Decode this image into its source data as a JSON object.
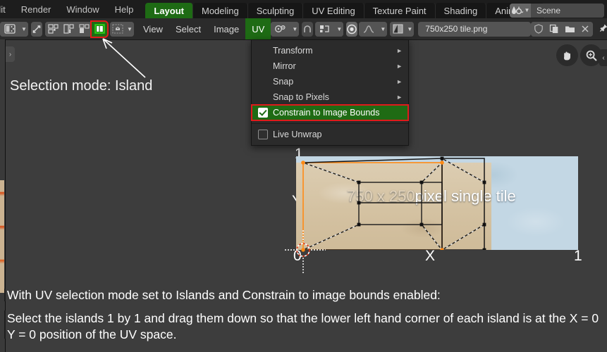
{
  "window": {
    "topbar": {
      "menus": [
        "dit",
        "Render",
        "Window",
        "Help"
      ],
      "workspace_tabs": [
        {
          "label": "Layout",
          "active": true
        },
        {
          "label": "Modeling",
          "active": false
        },
        {
          "label": "Sculpting",
          "active": false
        },
        {
          "label": "UV Editing",
          "active": false
        },
        {
          "label": "Texture Paint",
          "active": false
        },
        {
          "label": "Shading",
          "active": false
        },
        {
          "label": "Animation",
          "active": false
        }
      ],
      "scene": {
        "name": "Scene",
        "icon": "scene-icon"
      }
    },
    "editor_header": {
      "editor_type_icon": "uv-editor-icon",
      "sync_icon": "uv-sync-selection-icon",
      "selection_modes": [
        {
          "name": "vertex",
          "icon": "uv-vertex-select-icon",
          "active": false
        },
        {
          "name": "edge",
          "icon": "uv-edge-select-icon",
          "active": false
        },
        {
          "name": "face",
          "icon": "uv-face-select-icon",
          "active": false
        },
        {
          "name": "island",
          "icon": "uv-island-select-icon",
          "active": true
        }
      ],
      "sticky_icon": "sticky-selection-icon",
      "menus": [
        {
          "label": "View",
          "active": false
        },
        {
          "label": "Select",
          "active": false
        },
        {
          "label": "Image",
          "active": false
        },
        {
          "label": "UV",
          "active": true
        }
      ],
      "pivot_icon": "pivot-point-icon",
      "snap_magnet_icon": "snap-magnet-icon",
      "snap_to_icon": "snap-target-icon",
      "proportional_icon": "proportional-editing-icon",
      "falloff_icon": "falloff-curve-icon",
      "image_browse_icon": "image-datablock-icon",
      "image_name": "750x250 tile.png",
      "fake_user_icon": "shield-icon",
      "new_image_icon": "copy-icon",
      "open_image_icon": "folder-icon",
      "unlink_icon": "close-icon",
      "pin_icon": "pin-icon"
    },
    "uv_menu": {
      "items": [
        {
          "label": "Transform",
          "underline": "T",
          "submenu": true,
          "checkbox": null,
          "highlighted": false
        },
        {
          "label": "Mirror",
          "underline": "M",
          "submenu": true,
          "checkbox": null,
          "highlighted": false
        },
        {
          "label": "Snap",
          "underline": "S",
          "submenu": true,
          "checkbox": null,
          "highlighted": false
        },
        {
          "label": "Snap to Pixels",
          "underline": "P",
          "submenu": true,
          "checkbox": null,
          "highlighted": false
        },
        {
          "label": "Constrain to Image Bounds",
          "underline": "",
          "submenu": false,
          "checkbox": true,
          "highlighted": true
        },
        {
          "label": "Live Unwrap",
          "underline": "",
          "submenu": false,
          "checkbox": false,
          "highlighted": false
        }
      ]
    },
    "viewport": {
      "gizmos": [
        {
          "name": "pan-gizmo",
          "icon": "hand-icon"
        },
        {
          "name": "zoom-gizmo",
          "icon": "magnifier-icon"
        }
      ],
      "sidebar_toggle_icon": "chevron-left-icon",
      "toolbar_toggle_icon": "chevron-right-icon",
      "uv_space": {
        "axis_x_label": "X",
        "axis_y_label": "Y",
        "origin_label": "0",
        "top_label": "1",
        "right_label": "1",
        "image_overlay_text_a": "750 x 250",
        "image_overlay_text_b": "pixel single tile",
        "cursor2d": "2d-cursor-icon"
      }
    },
    "annotations": {
      "selection_mode_note": "Selection mode: Island",
      "instructions": [
        "With UV selection mode set to Islands and Constrain to image bounds enabled:",
        "Select the islands 1 by 1 and drag them down so that the lower left hand corner of each island is at the X = 0  Y = 0 position of the UV space."
      ]
    }
  },
  "colors": {
    "accent_green": "#1e6b14",
    "highlight_red": "#e01b1b",
    "uv_edge_orange": "#ff8a15",
    "bg_editor": "#3d3d3d",
    "bg_header": "#2b2b2b",
    "bg_topbar": "#1d1d1d",
    "tex_blue": "#c3d7e4",
    "tex_tan": "#d4c2a2"
  }
}
